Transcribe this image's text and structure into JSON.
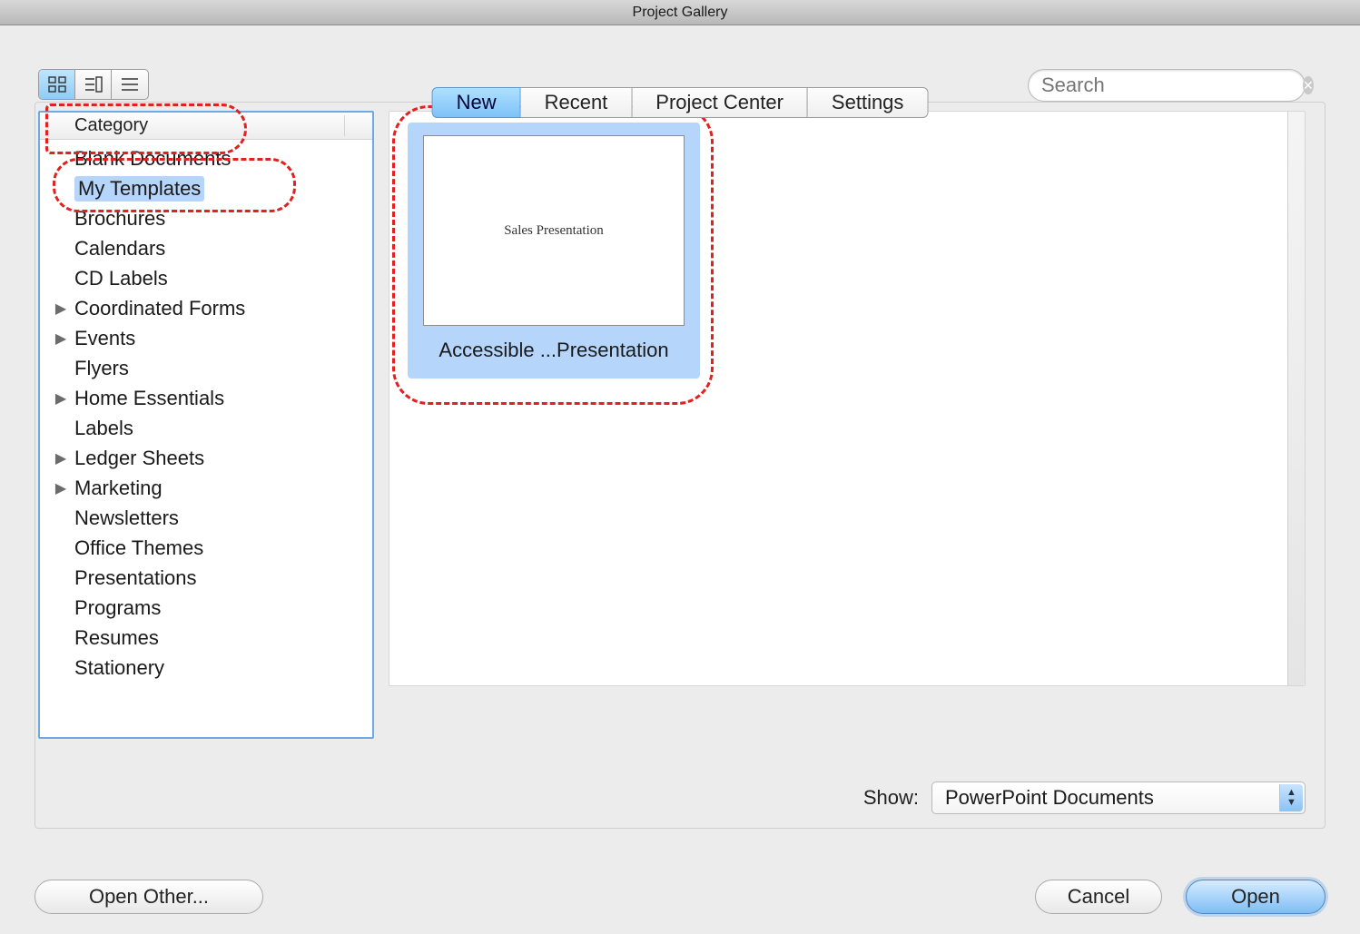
{
  "window": {
    "title": "Project Gallery"
  },
  "tabs": [
    {
      "label": "New",
      "active": true
    },
    {
      "label": "Recent",
      "active": false
    },
    {
      "label": "Project Center",
      "active": false
    },
    {
      "label": "Settings",
      "active": false
    }
  ],
  "search": {
    "placeholder": "Search",
    "value": ""
  },
  "category": {
    "header": "Category",
    "items": [
      {
        "label": "Blank Documents",
        "expandable": false,
        "selected": false
      },
      {
        "label": "My Templates",
        "expandable": false,
        "selected": true
      },
      {
        "label": "Brochures",
        "expandable": false,
        "selected": false
      },
      {
        "label": "Calendars",
        "expandable": false,
        "selected": false
      },
      {
        "label": "CD Labels",
        "expandable": false,
        "selected": false
      },
      {
        "label": "Coordinated Forms",
        "expandable": true,
        "selected": false
      },
      {
        "label": "Events",
        "expandable": true,
        "selected": false
      },
      {
        "label": "Flyers",
        "expandable": false,
        "selected": false
      },
      {
        "label": "Home Essentials",
        "expandable": true,
        "selected": false
      },
      {
        "label": "Labels",
        "expandable": false,
        "selected": false
      },
      {
        "label": "Ledger Sheets",
        "expandable": true,
        "selected": false
      },
      {
        "label": "Marketing",
        "expandable": true,
        "selected": false
      },
      {
        "label": "Newsletters",
        "expandable": false,
        "selected": false
      },
      {
        "label": "Office Themes",
        "expandable": false,
        "selected": false
      },
      {
        "label": "Presentations",
        "expandable": false,
        "selected": false
      },
      {
        "label": "Programs",
        "expandable": false,
        "selected": false
      },
      {
        "label": "Resumes",
        "expandable": false,
        "selected": false
      },
      {
        "label": "Stationery",
        "expandable": false,
        "selected": false
      }
    ]
  },
  "templates": [
    {
      "label": "Accessible ...Presentation",
      "preview_text": "Sales Presentation",
      "selected": true
    }
  ],
  "show": {
    "label": "Show:",
    "selected": "PowerPoint Documents"
  },
  "buttons": {
    "open_other": "Open Other...",
    "cancel": "Cancel",
    "open": "Open"
  }
}
